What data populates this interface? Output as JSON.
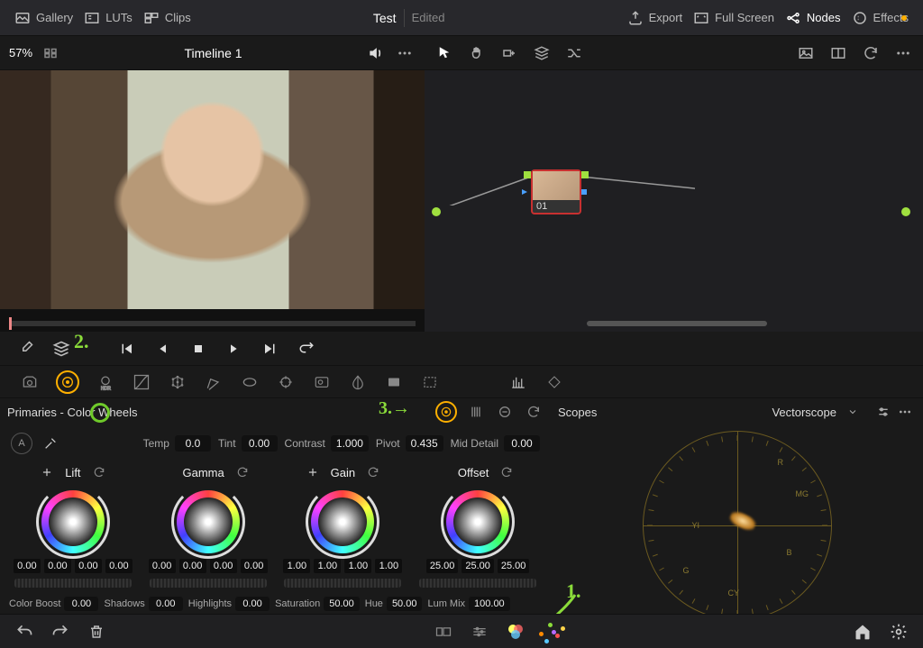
{
  "topbar": {
    "gallery": "Gallery",
    "luts": "LUTs",
    "clips": "Clips",
    "title": "Test",
    "state": "Edited",
    "export": "Export",
    "fullscreen": "Full Screen",
    "nodes": "Nodes",
    "effects": "Effects"
  },
  "viewer": {
    "zoom": "57%",
    "timeline": "Timeline 1"
  },
  "node": {
    "label": "01"
  },
  "panel": {
    "title": "Primaries - Color Wheels",
    "scopes_title": "Scopes",
    "scopes_mode": "Vectorscope"
  },
  "globals": {
    "temp_label": "Temp",
    "temp": "0.0",
    "tint_label": "Tint",
    "tint": "0.00",
    "contrast_label": "Contrast",
    "contrast": "1.000",
    "pivot_label": "Pivot",
    "pivot": "0.435",
    "mid_label": "Mid Detail",
    "mid": "0.00"
  },
  "wheels": {
    "lift": {
      "label": "Lift",
      "v": [
        "0.00",
        "0.00",
        "0.00",
        "0.00"
      ]
    },
    "gamma": {
      "label": "Gamma",
      "v": [
        "0.00",
        "0.00",
        "0.00",
        "0.00"
      ]
    },
    "gain": {
      "label": "Gain",
      "v": [
        "1.00",
        "1.00",
        "1.00",
        "1.00"
      ]
    },
    "offset": {
      "label": "Offset",
      "v": [
        "25.00",
        "25.00",
        "25.00"
      ]
    }
  },
  "bottom": {
    "colorboost_label": "Color Boost",
    "colorboost": "0.00",
    "shadows_label": "Shadows",
    "shadows": "0.00",
    "highlights_label": "Highlights",
    "highlights": "0.00",
    "saturation_label": "Saturation",
    "saturation": "50.00",
    "hue_label": "Hue",
    "hue": "50.00",
    "lummix_label": "Lum Mix",
    "lummix": "100.00"
  },
  "vectorscope_targets": [
    "R",
    "YI",
    "G",
    "CY",
    "B",
    "MG"
  ],
  "annotations": {
    "n1": "1.",
    "n2": "2.",
    "n3": "3.→"
  }
}
